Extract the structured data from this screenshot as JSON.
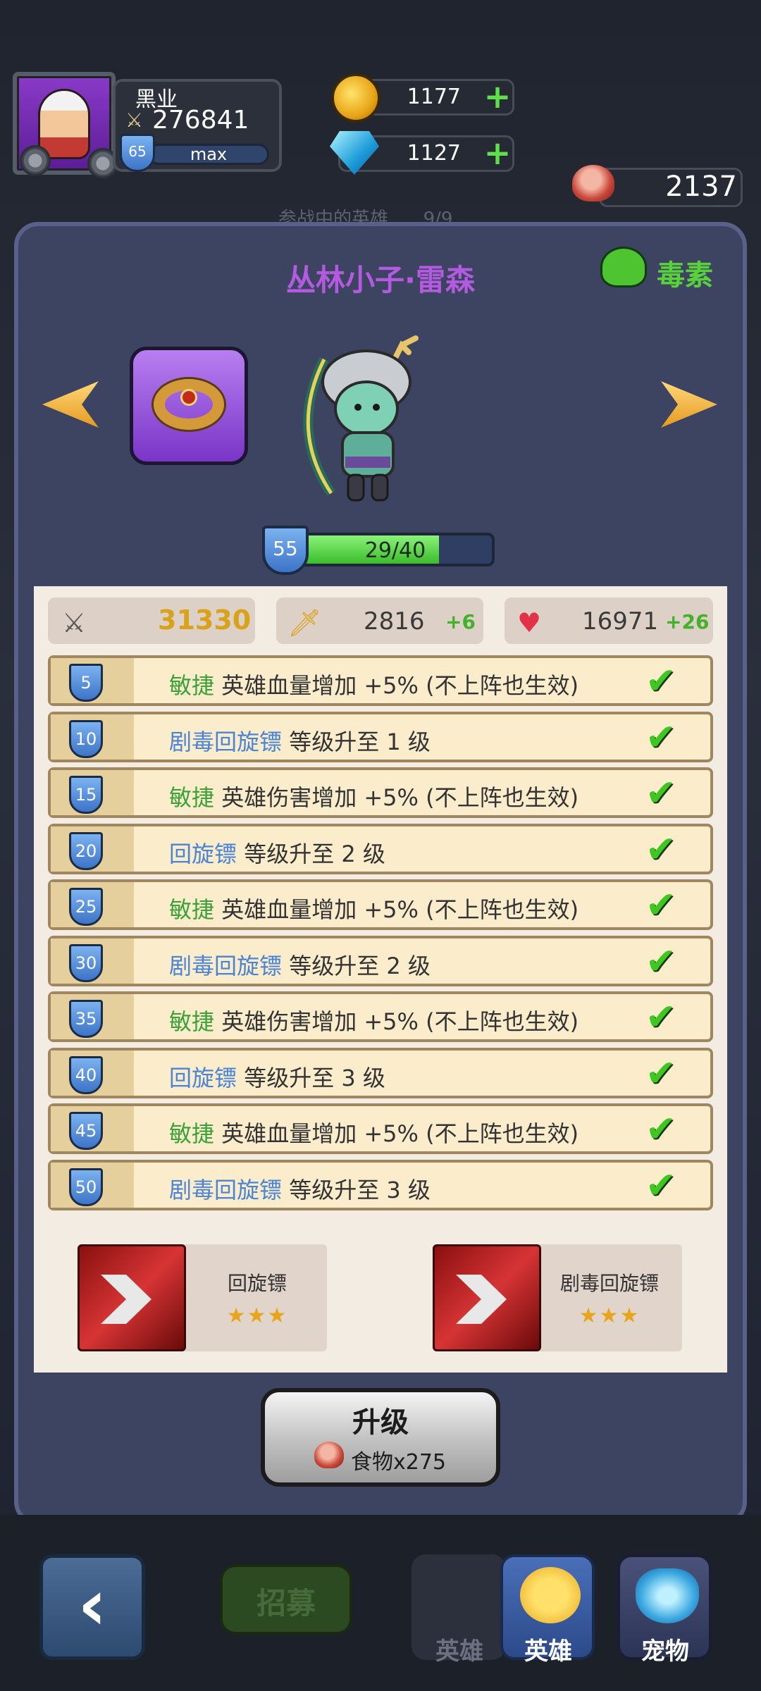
{
  "player": {
    "name": "黑业",
    "power": "276841",
    "level": "65",
    "level_bar_text": "max"
  },
  "currency": {
    "coins": "1177",
    "gems": "1127",
    "food": "2137"
  },
  "faded_header": "参战中的英雄      9/9",
  "hero": {
    "name": "丛林小子·雷森",
    "element": "毒素",
    "level": "55",
    "exp_text": "29/40",
    "exp_fraction": 0.725
  },
  "stats": {
    "attack": "31330",
    "defense": "2816",
    "defense_bonus": "+6",
    "hp": "16971",
    "hp_bonus": "+26"
  },
  "perks": [
    {
      "level": "5",
      "tag": "敏捷",
      "tag_color": "green",
      "text": "英雄血量增加 +5% (不上阵也生效)"
    },
    {
      "level": "10",
      "tag": "剧毒回旋镖",
      "tag_color": "blue",
      "text": "等级升至 1 级"
    },
    {
      "level": "15",
      "tag": "敏捷",
      "tag_color": "green",
      "text": "英雄伤害增加 +5% (不上阵也生效)"
    },
    {
      "level": "20",
      "tag": "回旋镖",
      "tag_color": "blue",
      "text": "等级升至 2 级"
    },
    {
      "level": "25",
      "tag": "敏捷",
      "tag_color": "green",
      "text": "英雄血量增加 +5% (不上阵也生效)"
    },
    {
      "level": "30",
      "tag": "剧毒回旋镖",
      "tag_color": "blue",
      "text": "等级升至 2 级"
    },
    {
      "level": "35",
      "tag": "敏捷",
      "tag_color": "green",
      "text": "英雄伤害增加 +5% (不上阵也生效)"
    },
    {
      "level": "40",
      "tag": "回旋镖",
      "tag_color": "blue",
      "text": "等级升至 3 级"
    },
    {
      "level": "45",
      "tag": "敏捷",
      "tag_color": "green",
      "text": "英雄血量增加 +5% (不上阵也生效)"
    },
    {
      "level": "50",
      "tag": "剧毒回旋镖",
      "tag_color": "blue",
      "text": "等级升至 3 级"
    }
  ],
  "skills": [
    {
      "name": "回旋镖",
      "stars": "★★★"
    },
    {
      "name": "剧毒回旋镖",
      "stars": "★★★"
    }
  ],
  "upgrade": {
    "label": "升级",
    "cost": "食物x275"
  },
  "bottom_nav": {
    "recruit": "招募",
    "tabs": [
      {
        "label": "英雄",
        "active": true
      },
      {
        "label": "宠物",
        "active": false
      }
    ],
    "faded_tab": "英雄"
  },
  "colors": {
    "panel": "#3d4461",
    "accent_purple": "#b45ae0",
    "poison_green": "#59d13b",
    "check_green": "#3ec621",
    "tag_blue": "#4a84d4"
  }
}
